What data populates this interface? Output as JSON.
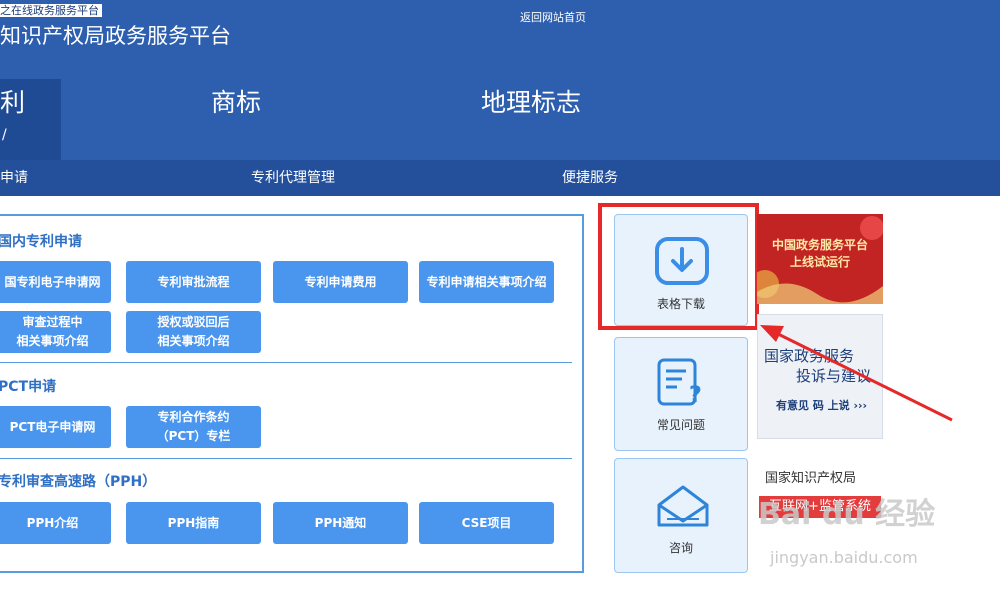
{
  "header": {
    "site_tag": "之在线政务服务平台",
    "site_title": "知识产权局政务服务平台",
    "home_link": "返回网站首页"
  },
  "main_tabs": [
    {
      "label": "利",
      "active": true
    },
    {
      "label": "商标"
    },
    {
      "label": "地理标志"
    }
  ],
  "subnav": [
    "申请",
    "专利代理管理",
    "便捷服务"
  ],
  "sections": {
    "domestic": {
      "title": "国内专利申请",
      "buttons": [
        "国专利电子申请网",
        "专利审批流程",
        "专利申请费用",
        "专利申请相关事项介绍",
        "审查过程中\n相关事项介绍",
        "授权或驳回后\n相关事项介绍"
      ]
    },
    "pct": {
      "title": "PCT申请",
      "buttons": [
        "PCT电子申请网",
        "专利合作条约\n（PCT）专栏"
      ]
    },
    "pph": {
      "title": "专利审查高速路（PPH）",
      "buttons": [
        "PPH介绍",
        "PPH指南",
        "PPH通知",
        "CSE项目"
      ]
    }
  },
  "service_cards": [
    {
      "label": "表格下载",
      "icon": "download-icon"
    },
    {
      "label": "常见问题",
      "icon": "faq-icon"
    },
    {
      "label": "咨询",
      "icon": "envelope-icon"
    }
  ],
  "banners": {
    "gov_platform": {
      "line1": "中国政务服务平台",
      "line2": "上线试运行"
    },
    "complaint": {
      "line1": "国家政务服务",
      "line2": "投诉与建议",
      "line3": "有意见 码 上说 ›››"
    },
    "cnipa": {
      "line1": "国家知识产权局",
      "line2": "互联网+监管系统"
    }
  },
  "watermark": {
    "brand": "Bai du 经验",
    "url": "jingyan.baidu.com"
  },
  "colors": {
    "header_blue": "#2d5fae",
    "active_tab": "#1f4a94",
    "button_blue": "#4a95ee",
    "highlight_red": "#e52828"
  }
}
